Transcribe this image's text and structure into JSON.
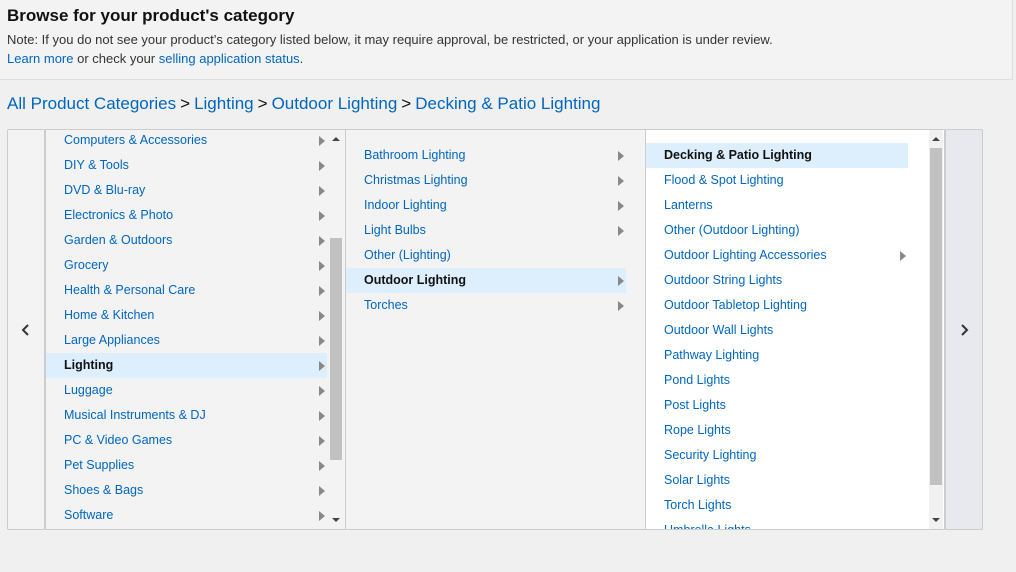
{
  "header": {
    "title": "Browse for your product's category",
    "note": "Note: If you do not see your product’s category listed below, it may require approval, be restricted, or your application is under review.",
    "learn_more": "Learn more",
    "or_check": " or check your ",
    "status_link": "selling application status",
    "period": "."
  },
  "breadcrumb": {
    "items": [
      "All Product Categories",
      "Lighting",
      "Outdoor Lighting",
      "Decking & Patio Lighting"
    ],
    "separator": ">"
  },
  "columns": {
    "col1": {
      "items": [
        {
          "label": "Computers & Accessories",
          "has_children": true
        },
        {
          "label": "DIY & Tools",
          "has_children": true
        },
        {
          "label": "DVD & Blu-ray",
          "has_children": true
        },
        {
          "label": "Electronics & Photo",
          "has_children": true
        },
        {
          "label": "Garden & Outdoors",
          "has_children": true
        },
        {
          "label": "Grocery",
          "has_children": true
        },
        {
          "label": "Health & Personal Care",
          "has_children": true
        },
        {
          "label": "Home & Kitchen",
          "has_children": true
        },
        {
          "label": "Large Appliances",
          "has_children": true
        },
        {
          "label": "Lighting",
          "has_children": true,
          "selected": true
        },
        {
          "label": "Luggage",
          "has_children": true
        },
        {
          "label": "Musical Instruments & DJ",
          "has_children": true
        },
        {
          "label": "PC & Video Games",
          "has_children": true
        },
        {
          "label": "Pet Supplies",
          "has_children": true
        },
        {
          "label": "Shoes & Bags",
          "has_children": true
        },
        {
          "label": "Software",
          "has_children": true
        }
      ]
    },
    "col2": {
      "items": [
        {
          "label": "Bathroom Lighting",
          "has_children": true
        },
        {
          "label": "Christmas Lighting",
          "has_children": true
        },
        {
          "label": "Indoor Lighting",
          "has_children": true
        },
        {
          "label": "Light Bulbs",
          "has_children": true
        },
        {
          "label": "Other (Lighting)",
          "has_children": false
        },
        {
          "label": "Outdoor Lighting",
          "has_children": true,
          "selected": true
        },
        {
          "label": "Torches",
          "has_children": true
        }
      ]
    },
    "col3": {
      "items": [
        {
          "label": "Decking & Patio Lighting",
          "has_children": false,
          "selected": true
        },
        {
          "label": "Flood & Spot Lighting",
          "has_children": false
        },
        {
          "label": "Lanterns",
          "has_children": false
        },
        {
          "label": "Other (Outdoor Lighting)",
          "has_children": false
        },
        {
          "label": "Outdoor Lighting Accessories",
          "has_children": true
        },
        {
          "label": "Outdoor String Lights",
          "has_children": false
        },
        {
          "label": "Outdoor Tabletop Lighting",
          "has_children": false
        },
        {
          "label": "Outdoor Wall Lights",
          "has_children": false
        },
        {
          "label": "Pathway Lighting",
          "has_children": false
        },
        {
          "label": "Pond Lights",
          "has_children": false
        },
        {
          "label": "Post Lights",
          "has_children": false
        },
        {
          "label": "Rope Lights",
          "has_children": false
        },
        {
          "label": "Security Lighting",
          "has_children": false
        },
        {
          "label": "Solar Lights",
          "has_children": false
        },
        {
          "label": "Torch Lights",
          "has_children": false
        },
        {
          "label": "Umbrella Lights",
          "has_children": false
        }
      ]
    }
  },
  "icons": {
    "prev": "chevron-left-icon",
    "next": "chevron-right-icon",
    "submenu": "submenu-arrow-icon"
  },
  "colors": {
    "link": "#0066c0",
    "selected_bg": "#ddeefc"
  }
}
